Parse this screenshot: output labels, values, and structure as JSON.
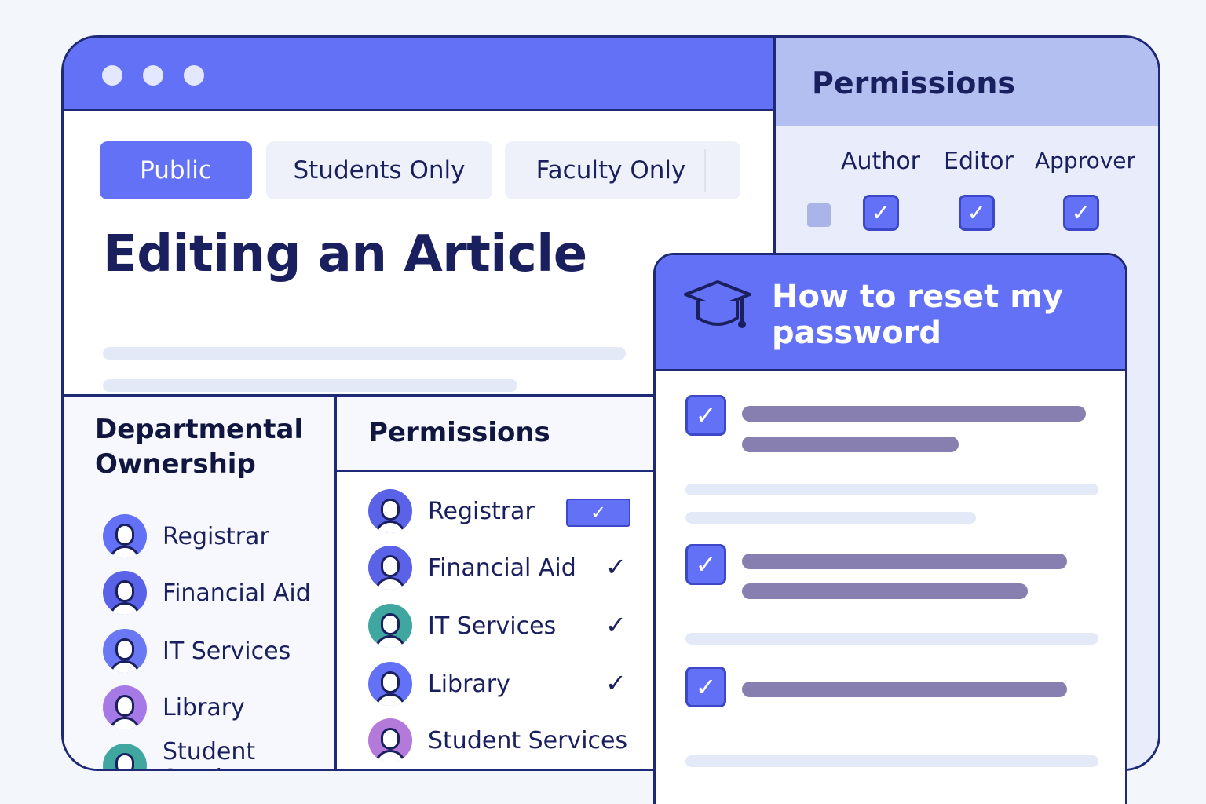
{
  "editor": {
    "tabs": [
      {
        "label": "Public",
        "active": true
      },
      {
        "label": "Students Only",
        "active": false
      },
      {
        "label": "Faculty Only",
        "active": false
      }
    ],
    "title": "Editing an Article"
  },
  "departments": {
    "heading": "Departmental Ownership",
    "items": [
      {
        "label": "Registrar",
        "avatar_color": "#6271f6"
      },
      {
        "label": "Financial Aid",
        "avatar_color": "#5a62e8"
      },
      {
        "label": "IT Services",
        "avatar_color": "#6b78f3"
      },
      {
        "label": "Library",
        "avatar_color": "#a57ae6"
      },
      {
        "label": "Student Services",
        "avatar_color": "#3fa79f"
      }
    ]
  },
  "permissions_list": {
    "heading": "Permissions",
    "items": [
      {
        "label": "Registrar",
        "check_style": "pill",
        "checked": true,
        "avatar_color": "#5a62e8"
      },
      {
        "label": "Financial Aid",
        "check_style": "mark",
        "checked": true,
        "avatar_color": "#5a62e8"
      },
      {
        "label": "IT Services",
        "check_style": "mark",
        "checked": true,
        "avatar_color": "#3fa79f"
      },
      {
        "label": "Library",
        "check_style": "mark",
        "checked": true,
        "avatar_color": "#6271f6"
      },
      {
        "label": "Student Services",
        "check_style": "none",
        "checked": false,
        "avatar_color": "#b47ad9"
      }
    ],
    "check_glyph": "✓"
  },
  "roles_panel": {
    "title": "Permissions",
    "roles": [
      {
        "label": "Author",
        "checked": true
      },
      {
        "label": "Editor",
        "checked": true
      },
      {
        "label": "Approver",
        "checked": true
      }
    ]
  },
  "help_card": {
    "title": "How to reset my password",
    "icon": "graduation-cap-icon",
    "steps_checked": [
      true,
      true,
      true
    ]
  },
  "colors": {
    "accent": "#6271f6",
    "accent_dark": "#1e2a78",
    "panel_light": "#e8ecfb",
    "header_light": "#b3bff0",
    "placeholder_bar": "#867fb0"
  }
}
